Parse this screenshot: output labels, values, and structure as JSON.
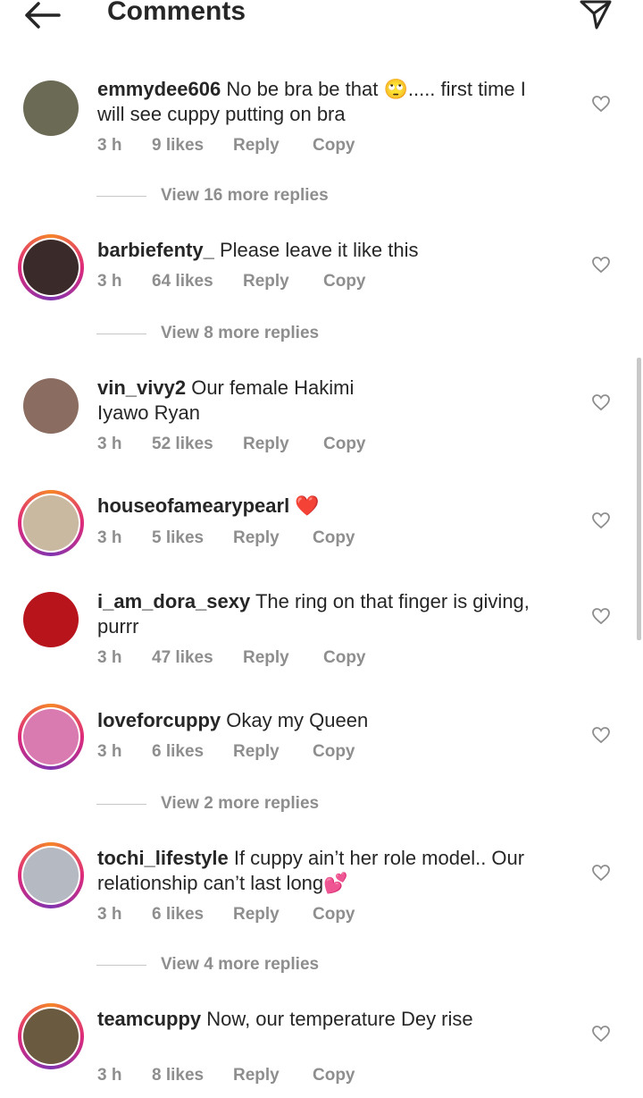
{
  "header": {
    "title": "Comments",
    "back_icon": "arrow-left-icon",
    "send_icon": "paper-plane-icon"
  },
  "comments": [
    {
      "username": "emmydee606",
      "text_line1": "No be bra be that 🙄..... first time I",
      "text_line2": "will see cuppy putting on bra",
      "time": "3 h",
      "likes": "9 likes",
      "reply": "Reply",
      "copy": "Copy",
      "ring": false,
      "avatar_color": "#6b6a55"
    },
    {
      "username": "barbiefenty_",
      "text_line1": "Please leave it like this",
      "time": "3 h",
      "likes": "64 likes",
      "reply": "Reply",
      "copy": "Copy",
      "ring": true,
      "avatar_color": "#3a2a2a"
    },
    {
      "username": "vin_vivy2",
      "text_line1": "Our female Hakimi",
      "text_line2": "Iyawo Ryan",
      "time": "3 h",
      "likes": "52 likes",
      "reply": "Reply",
      "copy": "Copy",
      "ring": false,
      "avatar_color": "#8a6c60"
    },
    {
      "username": "houseofamearypearl",
      "text_line1": "❤️",
      "time": "3 h",
      "likes": "5 likes",
      "reply": "Reply",
      "copy": "Copy",
      "ring": true,
      "avatar_color": "#c9b9a1"
    },
    {
      "username": "i_am_dora_sexy",
      "text_line1": "The ring on that finger is giving,",
      "text_line2": "purrr",
      "time": "3 h",
      "likes": "47 likes",
      "reply": "Reply",
      "copy": "Copy",
      "ring": false,
      "avatar_color": "#b8141c"
    },
    {
      "username": "loveforcuppy",
      "text_line1": "Okay my Queen",
      "time": "3 h",
      "likes": "6 likes",
      "reply": "Reply",
      "copy": "Copy",
      "ring": true,
      "avatar_color": "#d97ab0"
    },
    {
      "username": "tochi_lifestyle",
      "text_line1": "If cuppy ain’t her role model.. Our",
      "text_line2": "relationship can’t last long💕",
      "time": "3 h",
      "likes": "6 likes",
      "reply": "Reply",
      "copy": "Copy",
      "ring": true,
      "avatar_color": "#b5b9c2"
    },
    {
      "username": "teamcuppy",
      "text_line1": "Now, our temperature Dey rise",
      "time": "3 h",
      "likes": "8 likes",
      "reply": "Reply",
      "copy": "Copy",
      "ring": true,
      "avatar_color": "#6a5a40"
    }
  ],
  "view_replies": [
    "View 16 more replies",
    "View 8 more replies",
    "View 2 more replies",
    "View 4 more replies"
  ]
}
